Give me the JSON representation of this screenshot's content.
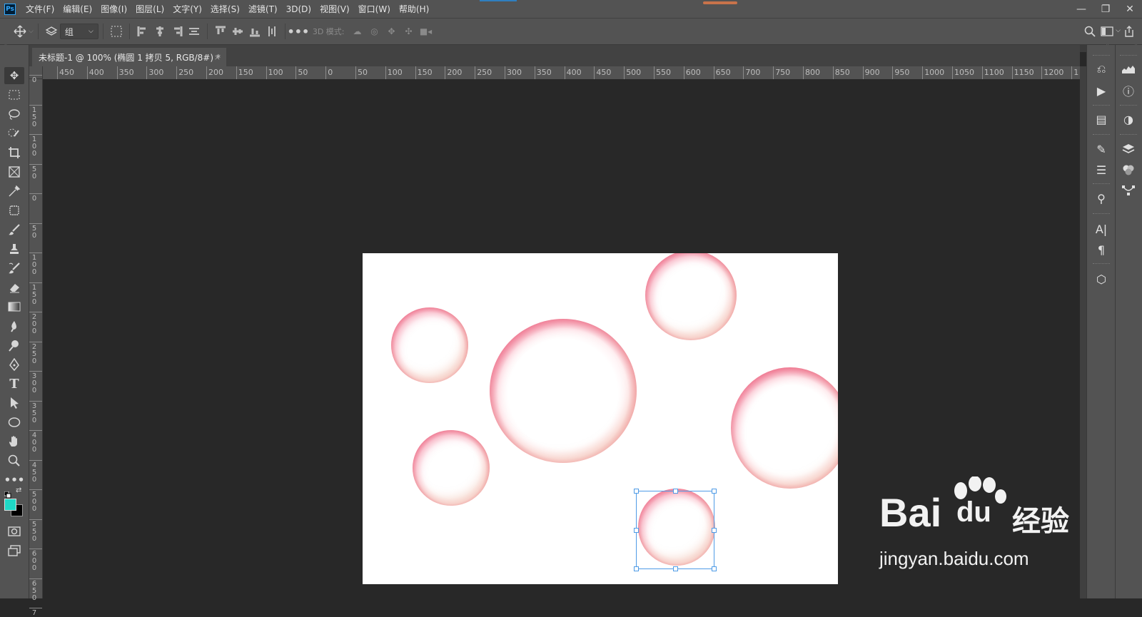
{
  "menubar": {
    "logo": "Ps",
    "items": [
      "文件(F)",
      "编辑(E)",
      "图像(I)",
      "图层(L)",
      "文字(Y)",
      "选择(S)",
      "滤镜(T)",
      "3D(D)",
      "视图(V)",
      "窗口(W)",
      "帮助(H)"
    ],
    "window_controls": [
      "—",
      "❐",
      "✕"
    ]
  },
  "options": {
    "group_select": "组",
    "mode_label": "3D 模式:"
  },
  "tab": {
    "title": "未标题-1 @ 100% (椭圆 1 拷贝 5, RGB/8#) *",
    "close": "×"
  },
  "ruler": {
    "h_labels": [
      "450",
      "400",
      "350",
      "300",
      "250",
      "200",
      "150",
      "100",
      "50",
      "0",
      "50",
      "100",
      "150",
      "200",
      "250",
      "300",
      "350",
      "400",
      "450",
      "500",
      "550",
      "600",
      "650",
      "700",
      "750",
      "800",
      "850",
      "900",
      "950",
      "1000",
      "1050",
      "1100",
      "1150",
      "1200",
      "1"
    ],
    "v_labels": [
      "0",
      "1 5 0",
      "1 0 0",
      "5 0",
      "0",
      "5 0",
      "1 0 0",
      "1 5 0",
      "2 0 0",
      "2 5 0",
      "3 0 0",
      "3 5 0",
      "4 0 0",
      "4 5 0",
      "5 0 0",
      "5 5 0",
      "6 0 0",
      "6 5 0",
      "7"
    ]
  },
  "document": {
    "background": "#ffffff",
    "accent_color": "#dc2850"
  },
  "colors": {
    "foreground": "#1fd8c6",
    "background": "#000000"
  },
  "watermark": {
    "brand": "Bai",
    "brand2": "du",
    "suffix": "经验",
    "url": "jingyan.baidu.com"
  }
}
